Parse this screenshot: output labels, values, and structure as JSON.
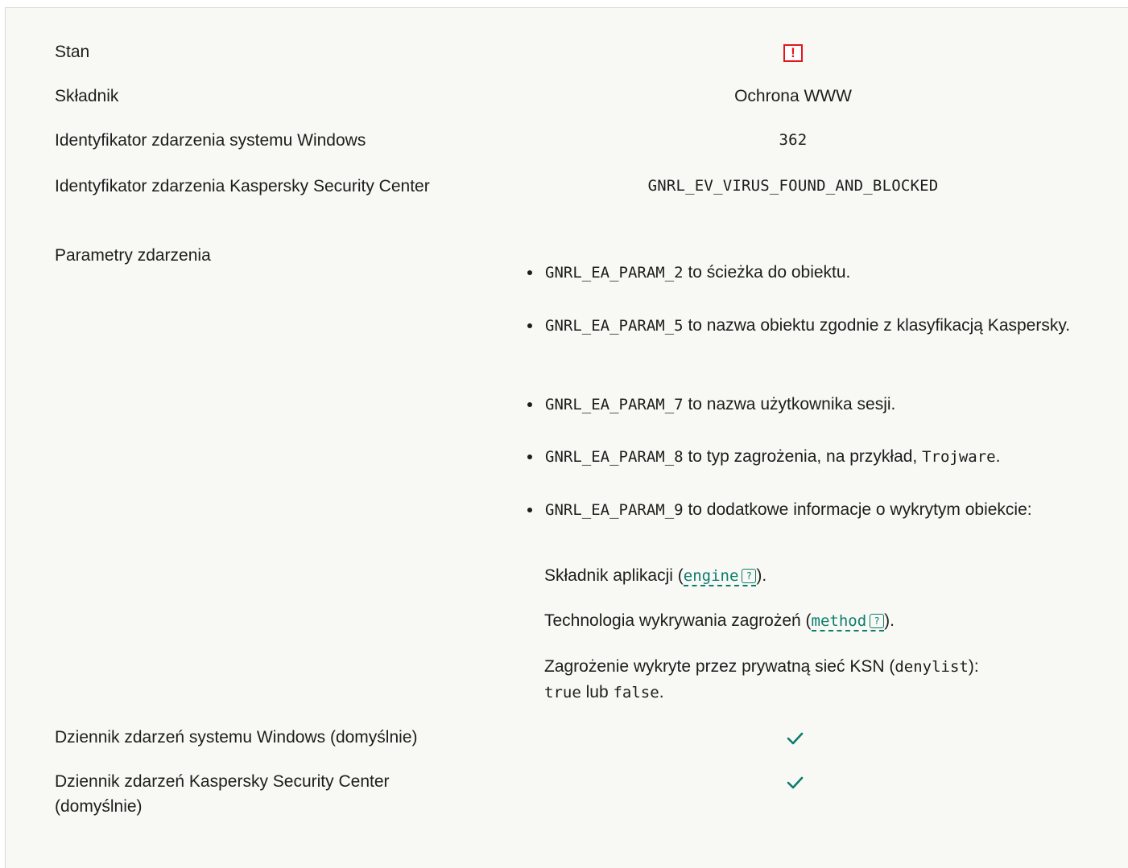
{
  "rows": {
    "status": {
      "label": "Stan",
      "icon": "warning-icon",
      "icon_glyph": "!"
    },
    "component": {
      "label": "Składnik",
      "value": "Ochrona WWW"
    },
    "windows_event_id": {
      "label": "Identyfikator zdarzenia systemu Windows",
      "value": "362"
    },
    "ksc_event_id": {
      "label": "Identyfikator zdarzenia Kaspersky Security Center",
      "value": "GNRL_EV_VIRUS_FOUND_AND_BLOCKED"
    },
    "event_params": {
      "label": "Parametry zdarzenia"
    },
    "windows_log": {
      "label": "Dziennik zdarzeń systemu Windows (domyślnie)",
      "icon": "checkmark-icon"
    },
    "ksc_log": {
      "label": "Dziennik zdarzeń Kaspersky Security Center (domyślnie)",
      "icon": "checkmark-icon"
    }
  },
  "params": [
    {
      "code": "GNRL_EA_PARAM_2",
      "text": "to ścieżka do obiektu."
    },
    {
      "code": "GNRL_EA_PARAM_5",
      "text": "to nazwa obiektu zgodnie z klasyfikacją Kaspersky."
    },
    {
      "code": "GNRL_EA_PARAM_7",
      "text": "to nazwa użytkownika sesji."
    },
    {
      "code": "GNRL_EA_PARAM_8",
      "text": "to typ zagrożenia, na przykład,",
      "example": "Trojware",
      "tail": "."
    },
    {
      "code": "GNRL_EA_PARAM_9",
      "text": "to dodatkowe informacje o wykrytym obiekcie:"
    }
  ],
  "param9_details": {
    "engine_prefix": "Składnik aplikacji (",
    "engine_term": "engine",
    "engine_suffix": ").",
    "method_prefix": "Technologia wykrywania zagrożeń (",
    "method_term": "method",
    "method_suffix": ").",
    "ksn_prefix": "Zagrożenie wykryte przez prywatną sieć KSN (",
    "ksn_code": "denylist",
    "ksn_suffix": "):",
    "true_code": "true",
    "or_text": "lub",
    "false_code": "false",
    "ksn_end": "."
  },
  "help_glyph": "?",
  "colors": {
    "panel_bg": "#f8f8f4",
    "text": "#1d1d1b",
    "warning": "#e3161e",
    "accent": "#0a7d6e"
  }
}
